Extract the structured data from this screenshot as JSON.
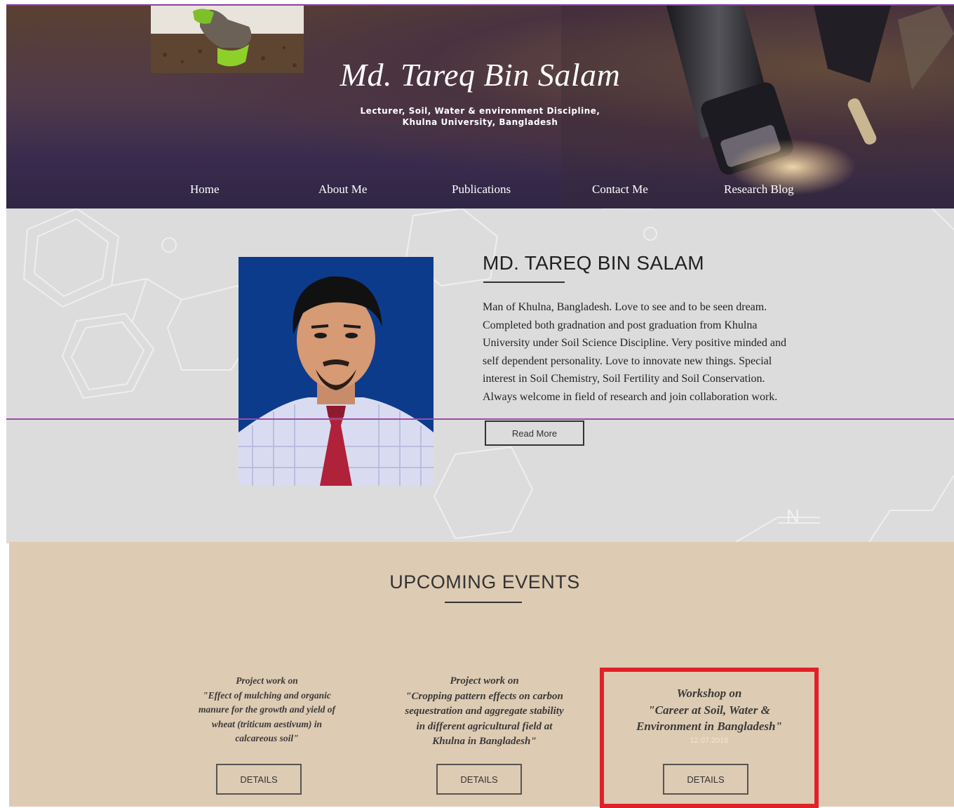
{
  "header": {
    "title": "Md. Tareq Bin Salam",
    "subtitle_line1": "Lecturer, Soil, Water & environment Discipline,",
    "subtitle_line2": "Khulna University, Bangladesh"
  },
  "nav": {
    "items": [
      {
        "label": "Home"
      },
      {
        "label": "About Me"
      },
      {
        "label": "Publications"
      },
      {
        "label": "Contact Me"
      },
      {
        "label": "Research Blog"
      }
    ]
  },
  "about": {
    "name": "MD. TAREQ BIN SALAM",
    "bio": "Man of Khulna, Bangladesh. Love to see and to be seen dream. Completed both gradnation and post graduation from Khulna University under Soil Science Discipline. Very positive minded and self dependent personality. Love to innovate new things. Special interest in Soil Chemistry, Soil Fertility and Soil Conservation. Always welcome in field of research and join collaboration work.",
    "read_more_label": "Read More",
    "bg_molecule_label": "N"
  },
  "events": {
    "title": "UPCOMING EVENTS",
    "items": [
      {
        "line1": "Project work on",
        "line2": "\"Effect of mulching and organic",
        "line3": "manure for the growth and yield of",
        "line4": "wheat (triticum aestivum) in",
        "line5": "calcareous soil\"",
        "details_label": "DETAILS"
      },
      {
        "line1": "Project work on",
        "line2": "\"Cropping pattern effects on carbon",
        "line3": "sequestration and aggregate stability",
        "line4": "in different agricultural field at",
        "line5": "Khulna in Bangladesh\"",
        "details_label": "DETAILS"
      },
      {
        "line1": "Workshop on",
        "line2": "\"Career at Soil, Water &",
        "line3": "Environment in Bangladesh\"",
        "date": "12.07.2016",
        "details_label": "DETAILS"
      }
    ]
  },
  "colors": {
    "highlight": "#e0212a",
    "events_bg": "#decbb3",
    "about_bg": "#dcdcdc"
  }
}
